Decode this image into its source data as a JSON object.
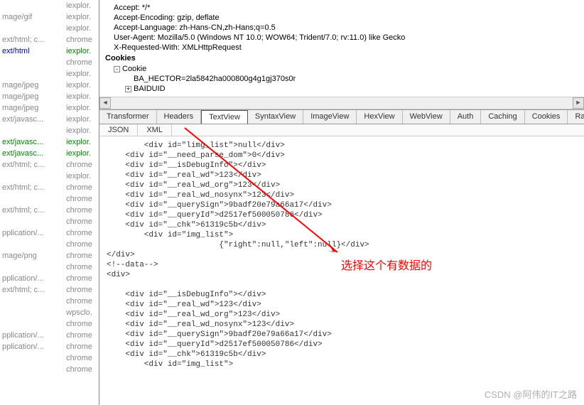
{
  "leftPanel": {
    "rows": [
      {
        "content": "",
        "process": "iexplor.",
        "ctColor": "",
        "pcColor": ""
      },
      {
        "content": "mage/gif",
        "process": "iexplor.",
        "ctColor": "",
        "pcColor": ""
      },
      {
        "content": "",
        "process": "iexplor.",
        "ctColor": "",
        "pcColor": ""
      },
      {
        "content": "ext/html; c...",
        "process": "chrome",
        "ctColor": "",
        "pcColor": ""
      },
      {
        "content": "ext/html",
        "process": "iexplor.",
        "ctColor": "blue",
        "pcColor": "green"
      },
      {
        "content": "",
        "process": "chrome",
        "ctColor": "",
        "pcColor": ""
      },
      {
        "content": "",
        "process": "iexplor.",
        "ctColor": "",
        "pcColor": ""
      },
      {
        "content": "mage/jpeg",
        "process": "iexplor.",
        "ctColor": "",
        "pcColor": ""
      },
      {
        "content": "mage/jpeg",
        "process": "iexplor.",
        "ctColor": "",
        "pcColor": ""
      },
      {
        "content": "mage/jpeg",
        "process": "iexplor.",
        "ctColor": "",
        "pcColor": ""
      },
      {
        "content": "ext/javasc...",
        "process": "iexplor.",
        "ctColor": "",
        "pcColor": ""
      },
      {
        "content": "",
        "process": "iexplor.",
        "ctColor": "",
        "pcColor": ""
      },
      {
        "content": "ext/javasc...",
        "process": "iexplor.",
        "ctColor": "green",
        "pcColor": "green"
      },
      {
        "content": "ext/javasc...",
        "process": "iexplor.",
        "ctColor": "green",
        "pcColor": "green"
      },
      {
        "content": "ext/html; c...",
        "process": "chrome",
        "ctColor": "",
        "pcColor": ""
      },
      {
        "content": "",
        "process": "iexplor.",
        "ctColor": "",
        "pcColor": ""
      },
      {
        "content": "ext/html; c...",
        "process": "chrome",
        "ctColor": "",
        "pcColor": ""
      },
      {
        "content": "",
        "process": "chrome",
        "ctColor": "",
        "pcColor": ""
      },
      {
        "content": "ext/html; c...",
        "process": "chrome",
        "ctColor": "",
        "pcColor": ""
      },
      {
        "content": "",
        "process": "chrome",
        "ctColor": "",
        "pcColor": ""
      },
      {
        "content": "pplication/...",
        "process": "chrome",
        "ctColor": "",
        "pcColor": ""
      },
      {
        "content": "",
        "process": "chrome",
        "ctColor": "",
        "pcColor": ""
      },
      {
        "content": "mage/png",
        "process": "chrome",
        "ctColor": "",
        "pcColor": ""
      },
      {
        "content": "",
        "process": "chrome",
        "ctColor": "",
        "pcColor": ""
      },
      {
        "content": "pplication/...",
        "process": "chrome",
        "ctColor": "",
        "pcColor": ""
      },
      {
        "content": "ext/html; c...",
        "process": "chrome",
        "ctColor": "",
        "pcColor": ""
      },
      {
        "content": "",
        "process": "chrome",
        "ctColor": "",
        "pcColor": ""
      },
      {
        "content": "",
        "process": "wpsclo.",
        "ctColor": "",
        "pcColor": ""
      },
      {
        "content": "",
        "process": "chrome",
        "ctColor": "",
        "pcColor": ""
      },
      {
        "content": "pplication/...",
        "process": "chrome",
        "ctColor": "",
        "pcColor": ""
      },
      {
        "content": "pplication/...",
        "process": "chrome",
        "ctColor": "",
        "pcColor": ""
      },
      {
        "content": "",
        "process": "chrome",
        "ctColor": "",
        "pcColor": ""
      },
      {
        "content": "",
        "process": "chrome",
        "ctColor": "",
        "pcColor": ""
      }
    ]
  },
  "requestHeaders": {
    "accept": "Accept: */*",
    "acceptEncoding": "Accept-Encoding: gzip, deflate",
    "acceptLanguage": "Accept-Language: zh-Hans-CN,zh-Hans;q=0.5",
    "userAgent": "User-Agent: Mozilla/5.0 (Windows NT 10.0; WOW64; Trident/7.0; rv:11.0) like Gecko",
    "xRequestedWith": "X-Requested-With: XMLHttpRequest",
    "cookiesLabel": "Cookies",
    "cookieLabel": "Cookie",
    "baHector": "BA_HECTOR=2la5842ha000800g4g1gj370s0r",
    "baiduid": "BAIDUID"
  },
  "tabs": {
    "transformer": "Transformer",
    "headers": "Headers",
    "textview": "TextView",
    "syntaxview": "SyntaxView",
    "imageview": "ImageView",
    "hexview": "HexView",
    "webview": "WebView",
    "auth": "Auth",
    "caching": "Caching",
    "cookies": "Cookies",
    "raw": "Raw"
  },
  "subTabs": {
    "json": "JSON",
    "xml": "XML"
  },
  "responseBody": "        <div id=\"limg_list\">null</div>\n    <div id=\"__need_parse_dom\">0</div>\n    <div id=\"__isDebugInfo\"></div>\n    <div id=\"__real_wd\">123</div>\n    <div id=\"__real_wd_org\">123</div>\n    <div id=\"__real_wd_nosynx\">123</div>\n    <div id=\"__querySign\">9badf20e79a66a17</div>\n    <div id=\"__queryId\">d2517ef500050786</div>\n    <div id=\"__chk\">61319c5b</div>\n        <div id=\"img_list\">\n                        {\"right\":null,\"left\":null}</div>\n</div>\n<!--data-->\n<div>\n\n    <div id=\"__isDebugInfo\"></div>\n    <div id=\"__real_wd\">123</div>\n    <div id=\"__real_wd_org\">123</div>\n    <div id=\"__real_wd_nosynx\">123</div>\n    <div id=\"__querySign\">9badf20e79a66a17</div>\n    <div id=\"__queryId\">d2517ef500050786</div>\n    <div id=\"__chk\">61319c5b</div>\n        <div id=\"img_list\">",
  "annotation": "选择这个有数据的",
  "watermark": "CSDN @阿伟的IT之路",
  "treeMinus": "-",
  "treePlus": "+",
  "scrollLeft": "◄",
  "scrollRight": "►"
}
